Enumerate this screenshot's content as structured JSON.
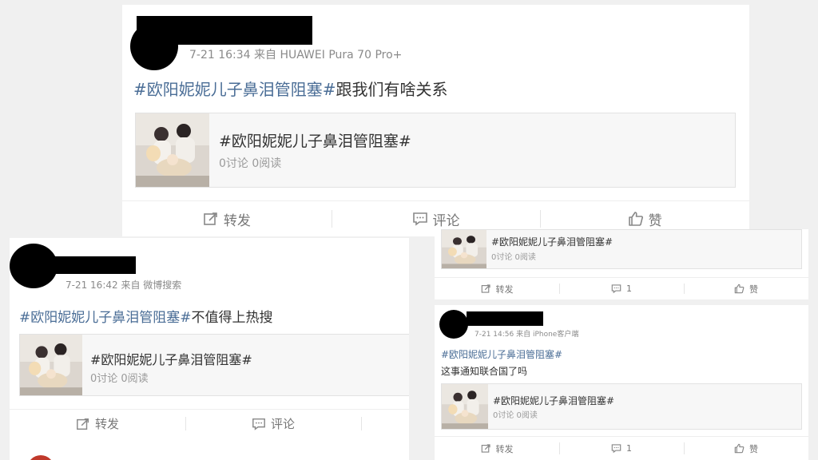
{
  "posts": [
    {
      "meta": "7-21 16:34 来自 HUAWEI Pura 70 Pro+",
      "hashtag": "#欧阳妮妮儿子鼻泪管阻塞#",
      "text": "跟我们有啥关系",
      "topic_title": "#欧阳妮妮儿子鼻泪管阻塞#",
      "topic_stats": "0讨论 0阅读",
      "repost_label": "转发",
      "comment_label": "评论",
      "like_label": "赞"
    },
    {
      "meta": "7-21 16:42 来自 微博搜索",
      "hashtag": "#欧阳妮妮儿子鼻泪管阻塞#",
      "text": "不值得上热搜",
      "topic_title": "#欧阳妮妮儿子鼻泪管阻塞#",
      "topic_stats": "0讨论 0阅读",
      "repost_label": "转发",
      "comment_label": "评论"
    },
    {
      "topic_title": "#欧阳妮妮儿子鼻泪管阻塞#",
      "topic_stats": "0讨论 0阅读",
      "repost_label": "转发",
      "comment_label": "1",
      "like_label": "赞"
    },
    {
      "meta": "7-21 14:56 来自 iPhone客户端",
      "hashtag": "#欧阳妮妮儿子鼻泪管阻塞#",
      "text": "这事通知联合国了吗",
      "topic_title": "#欧阳妮妮儿子鼻泪管阻塞#",
      "topic_stats": "0讨论 0阅读",
      "repost_label": "转发",
      "comment_label": "1",
      "like_label": "赞"
    }
  ],
  "icons": {
    "repost": "repost-icon",
    "comment": "comment-icon",
    "like": "like-icon"
  },
  "colors": {
    "hashtag": "#4a6d96",
    "meta": "#8a8a8a",
    "background": "#f0f0f0"
  }
}
